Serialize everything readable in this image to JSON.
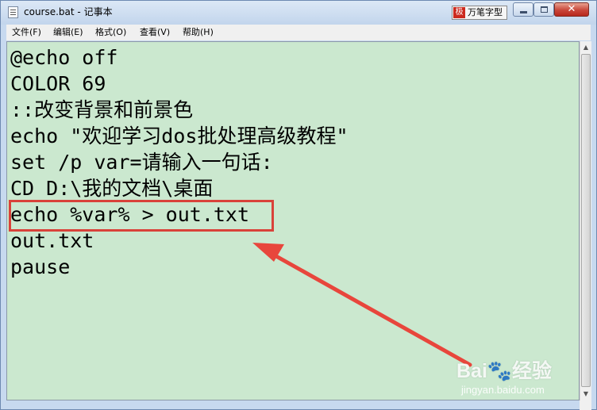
{
  "window": {
    "title": "course.bat - 记事本",
    "ime_label": "万笔字型",
    "ime_logo": "极",
    "close_glyph": "✕"
  },
  "menu": {
    "items": [
      {
        "label": "文件(F)"
      },
      {
        "label": "编辑(E)"
      },
      {
        "label": "格式(O)"
      },
      {
        "label": "查看(V)"
      },
      {
        "label": "帮助(H)"
      }
    ]
  },
  "editor": {
    "lines": [
      "@echo off",
      "COLOR 69",
      "::改变背景和前景色",
      "echo \"欢迎学习dos批处理高级教程\"",
      "set /p var=请输入一句话:",
      "CD D:\\我的文档\\桌面",
      "echo %var% > out.txt",
      "out.txt",
      "pause"
    ],
    "background": "#cbe8cf"
  },
  "annotation": {
    "box_color": "#d9423a",
    "arrow_color": "#e8463c"
  },
  "watermark": {
    "logo": "Bai🐾经验",
    "url": "jingyan.baidu.com"
  }
}
